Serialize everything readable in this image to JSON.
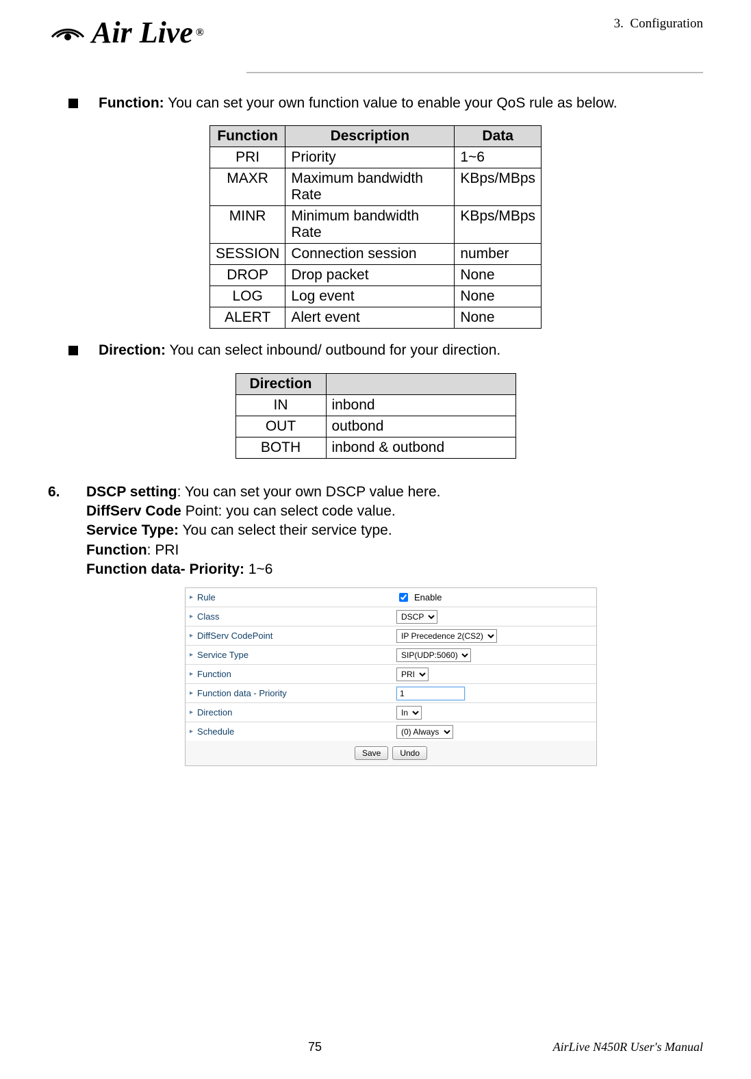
{
  "header": {
    "logo_text": "Air Live",
    "reg_mark": "®",
    "chapter": "3.",
    "chapter_title": "Configuration"
  },
  "section_function": {
    "label": "Function:",
    "desc": "You can set your own function value to enable your QoS rule as below.",
    "headers": [
      "Function",
      "Description",
      "Data"
    ],
    "rows": [
      [
        "PRI",
        "Priority",
        "1~6"
      ],
      [
        "MAXR",
        "Maximum bandwidth Rate",
        "KBps/MBps"
      ],
      [
        "MINR",
        "Minimum bandwidth Rate",
        "KBps/MBps"
      ],
      [
        "SESSION",
        "Connection session",
        "number"
      ],
      [
        "DROP",
        "Drop packet",
        "None"
      ],
      [
        "LOG",
        "Log event",
        "None"
      ],
      [
        "ALERT",
        "Alert event",
        "None"
      ]
    ]
  },
  "section_direction": {
    "label": "Direction:",
    "desc": "You can select inbound/ outbound for your direction.",
    "headers": [
      "Direction",
      ""
    ],
    "rows": [
      [
        "IN",
        "inbond"
      ],
      [
        "OUT",
        "outbond"
      ],
      [
        "BOTH",
        "inbond & outbond"
      ]
    ]
  },
  "section6": {
    "index": "6.",
    "lines": [
      {
        "bold": "DSCP setting",
        "rest": ": You can set your own DSCP value here."
      },
      {
        "bold": "DiffServ Code",
        "rest": " Point: you can select code value."
      },
      {
        "bold": "Service Type:",
        "rest": " You can select their service type."
      },
      {
        "bold": "Function",
        "rest": ": PRI"
      },
      {
        "bold": "Function data- Priority:",
        "rest": " 1~6"
      }
    ]
  },
  "form": {
    "fields": [
      {
        "label": "Rule",
        "type": "checkbox",
        "text": "Enable",
        "checked": true
      },
      {
        "label": "Class",
        "type": "select",
        "value": "DSCP"
      },
      {
        "label": "DiffServ CodePoint",
        "type": "select",
        "value": "IP Precedence 2(CS2)"
      },
      {
        "label": "Service Type",
        "type": "select",
        "value": "SIP(UDP:5060)"
      },
      {
        "label": "Function",
        "type": "select",
        "value": "PRI"
      },
      {
        "label": "Function data - Priority",
        "type": "input",
        "value": "1"
      },
      {
        "label": "Direction",
        "type": "select",
        "value": "In"
      },
      {
        "label": "Schedule",
        "type": "select",
        "value": "(0) Always"
      }
    ],
    "buttons": {
      "save": "Save",
      "undo": "Undo"
    }
  },
  "footer": {
    "page": "75",
    "manual": "AirLive N450R User's Manual"
  }
}
